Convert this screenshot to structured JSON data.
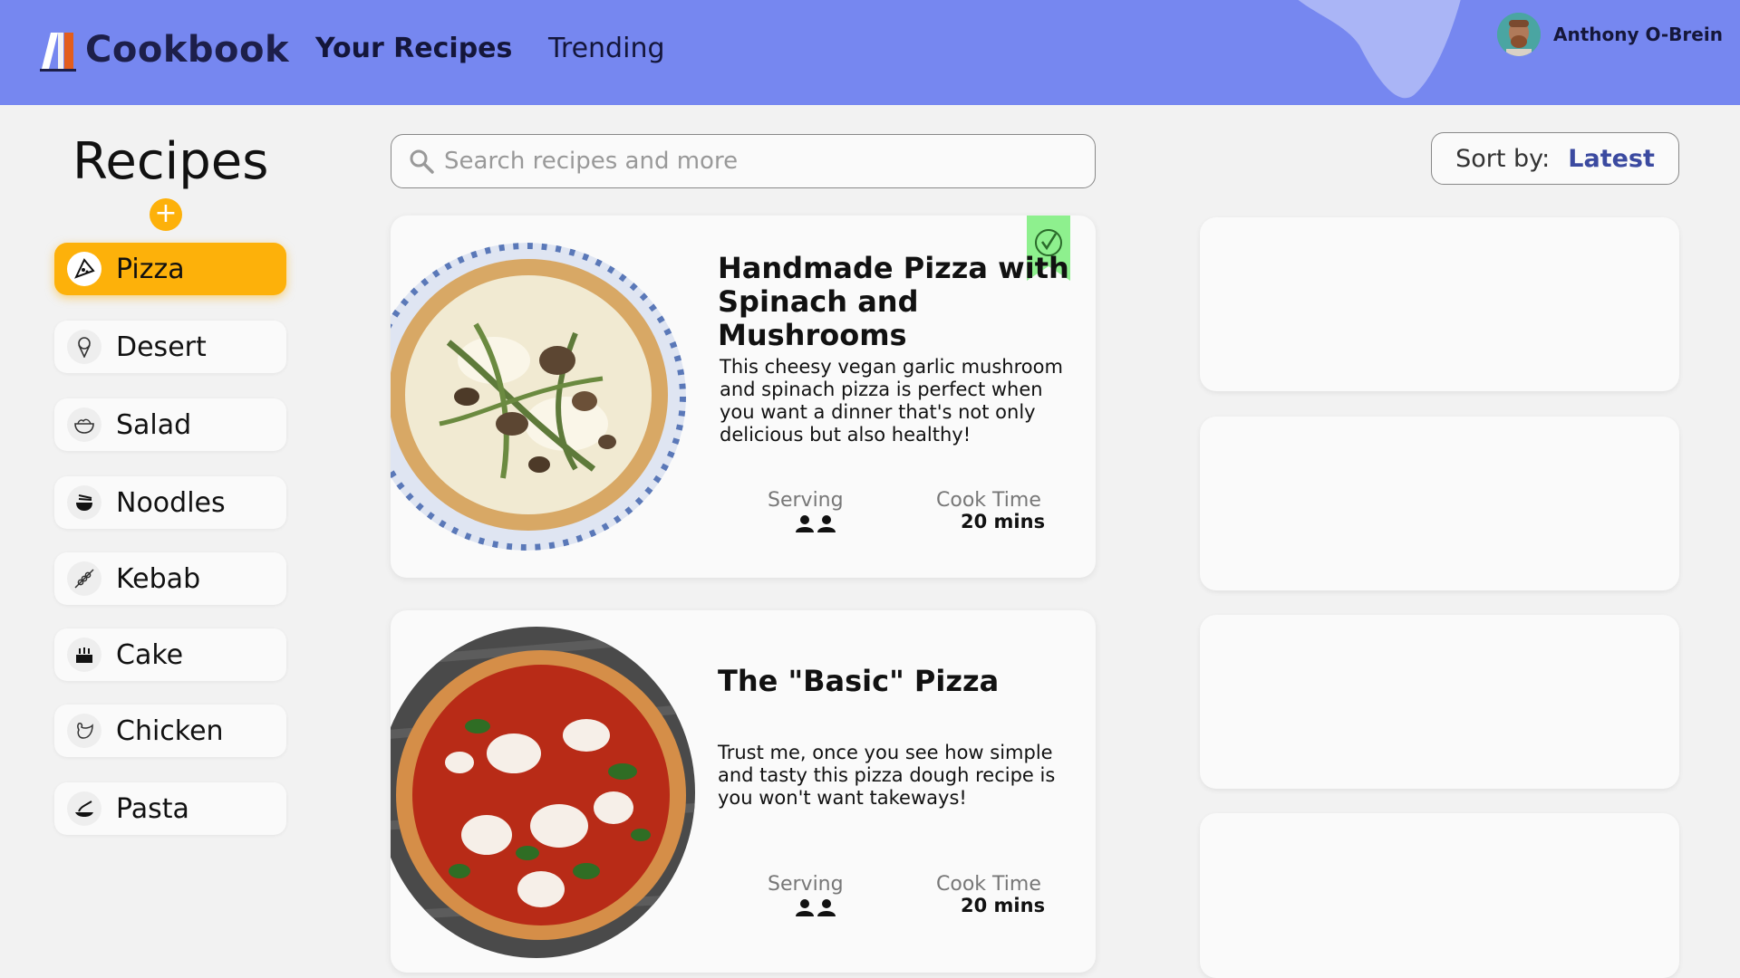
{
  "header": {
    "logo_text": "Cookbook",
    "nav": [
      "Your Recipes",
      "Trending"
    ],
    "user_name": "Anthony O-Brein",
    "background_color": "#7687f0"
  },
  "sidebar": {
    "title": "Recipes",
    "add_symbol": "+",
    "categories": [
      {
        "label": "Pizza",
        "icon": "pizza-icon",
        "glyph": "🍕",
        "active": true
      },
      {
        "label": "Desert",
        "icon": "ice-cream-icon",
        "glyph": "🍦",
        "active": false
      },
      {
        "label": "Salad",
        "icon": "salad-bowl-icon",
        "glyph": "🥗",
        "active": false
      },
      {
        "label": "Noodles",
        "icon": "noodles-icon",
        "glyph": "🍜",
        "active": false
      },
      {
        "label": "Kebab",
        "icon": "kebab-icon",
        "glyph": "🍢",
        "active": false
      },
      {
        "label": "Cake",
        "icon": "cake-icon",
        "glyph": "🎂",
        "active": false
      },
      {
        "label": "Chicken",
        "icon": "chicken-icon",
        "glyph": "🐔",
        "active": false
      },
      {
        "label": "Pasta",
        "icon": "pasta-icon",
        "glyph": "🍝",
        "active": false
      }
    ],
    "accent_color": "#fdb10a"
  },
  "search": {
    "placeholder": "Search recipes and more",
    "value": ""
  },
  "sort": {
    "label": "Sort by:",
    "value": "Latest"
  },
  "recipes": [
    {
      "title": "Handmade Pizza with Spinach and Mushrooms",
      "description": "This cheesy vegan garlic mushroom and spinach pizza is perfect when you want a dinner that's not only delicious but also healthy!",
      "serving_label": "Serving",
      "cook_time_label": "Cook Time",
      "cook_time": "20 mins",
      "bookmarked": true,
      "bookmark_color": "#8ef08e"
    },
    {
      "title": "The \"Basic\" Pizza",
      "description": "Trust me, once you see how simple and tasty this pizza dough recipe is you won't want takeways!",
      "serving_label": "Serving",
      "cook_time_label": "Cook Time",
      "cook_time": "20 mins",
      "bookmarked": false
    }
  ]
}
